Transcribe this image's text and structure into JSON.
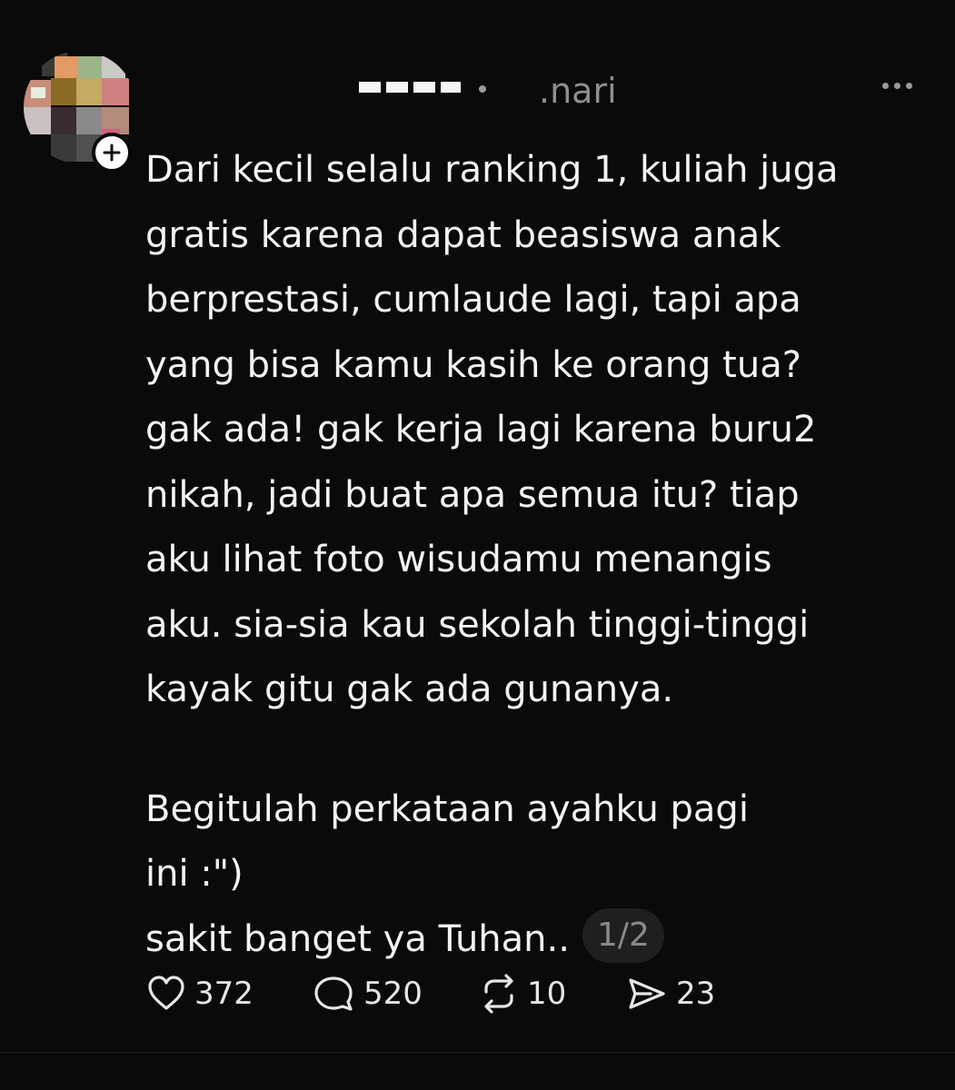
{
  "post": {
    "author_censored": "",
    "timestamp": ".nari",
    "body_paragraphs": [
      "Dari kecil selalu ranking 1, kuliah juga\ngratis karena dapat beasiswa anak\nberprestasi, cumlaude lagi, tapi apa\nyang bisa kamu kasih ke orang tua?\ngak ada! gak kerja lagi karena buru2\nnikah, jadi buat apa semua itu? tiap\naku lihat foto wisudamu menangis\naku. sia-sia kau sekolah tinggi-tinggi\nkayak gitu gak ada gunanya.",
      "Begitulah perkataan ayahku pagi\nini :\")\nsakit banget ya Tuhan.."
    ],
    "page_indicator": "1/2",
    "actions": {
      "likes": "372",
      "comments": "520",
      "reposts": "10",
      "shares": "23"
    }
  },
  "colors": {
    "background": "#0a0a0a",
    "text": "#f3f3f3",
    "muted": "#8f8f8f",
    "pill": "#1f1f1f"
  },
  "icons": [
    "heart-icon",
    "comment-icon",
    "repost-icon",
    "share-icon",
    "more-icon",
    "plus-icon"
  ]
}
